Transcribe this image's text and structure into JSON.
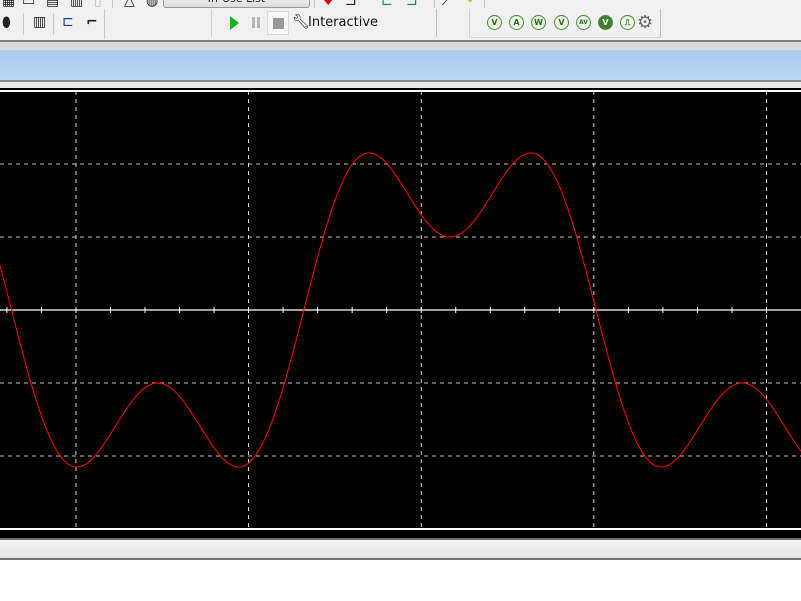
{
  "toolbar_top": {
    "in_use_list_label": "In-Use List"
  },
  "simulation": {
    "mode_label": "Interactive",
    "play_icon": "run-icon",
    "pause_icon": "pause-icon",
    "stop_icon": "stop-icon",
    "mode_icon": "wrench-icon"
  },
  "instruments": [
    {
      "icon": "voltmeter-probe-icon",
      "glyph": "V"
    },
    {
      "icon": "ammeter-probe-icon",
      "glyph": "A"
    },
    {
      "icon": "power-probe-icon",
      "glyph": "W"
    },
    {
      "icon": "differential-voltage-probe-icon",
      "glyph": "V"
    },
    {
      "icon": "voltage-current-probe-icon",
      "glyph": "AV"
    },
    {
      "icon": "reference-probe-icon",
      "glyph": "V"
    },
    {
      "icon": "digital-probe-icon",
      "glyph": "⎍"
    },
    {
      "icon": "probe-settings-gear-icon",
      "glyph": "⚙"
    }
  ],
  "chart_data": {
    "type": "line",
    "background": "#000000",
    "grid": true,
    "grid_color": "#ffffff",
    "grid_style": "dashed",
    "xlabel": "",
    "ylabel": "",
    "units": "divisions",
    "xlim": [
      -0.44,
      4.2
    ],
    "ylim": [
      -3,
      3
    ],
    "x_gridlines": [
      0,
      1,
      2,
      3,
      4
    ],
    "y_gridlines": [
      -2,
      -1,
      0,
      1,
      2
    ],
    "series": [
      {
        "color": "#ff0000",
        "waveform": "fundamental plus third harmonic",
        "fundamental_amplitude": 2.0,
        "third_harmonic_amplitude": 1.0,
        "period": 3.386,
        "rising_zero_crossing": 1.32
      }
    ]
  }
}
